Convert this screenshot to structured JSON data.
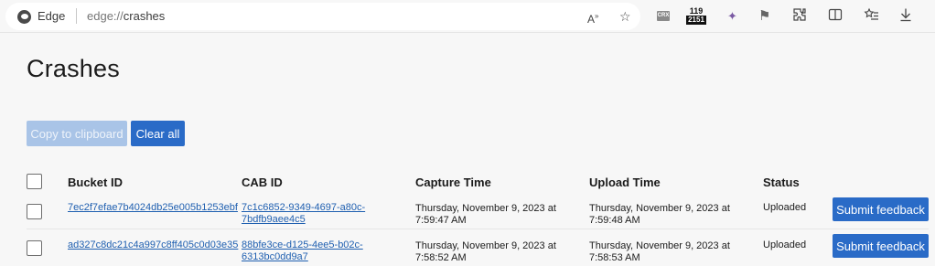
{
  "browser": {
    "name": "Edge",
    "url_scheme": "edge://",
    "url_path": "crashes",
    "read_aloud_label": "A",
    "read_aloud_sup": "»",
    "extension_crx": "CRX",
    "badge_top": "119",
    "badge_bottom": "2151",
    "icons": [
      "edge-logo-icon",
      "read-aloud-icon",
      "favorite-star-icon",
      "crx-extension-icon",
      "counter-badge-icon",
      "puzzle-icon",
      "flag-icon",
      "extensions-icon",
      "split-screen-icon",
      "favorites-icon",
      "download-icon"
    ]
  },
  "page": {
    "title": "Crashes",
    "copy_button": "Copy to clipboard",
    "clear_button": "Clear all"
  },
  "table": {
    "headers": {
      "bucket": "Bucket ID",
      "cab": "CAB ID",
      "capture": "Capture Time",
      "upload": "Upload Time",
      "status": "Status"
    },
    "rows": [
      {
        "bucket": "7ec2f7efae7b4024db25e005b1253ebf",
        "cab": "7c1c6852-9349-4697-a80c-7bdfb9aee4c5",
        "capture_date": "Thursday, November 9, 2023 at",
        "capture_time": "7:59:47 AM",
        "upload_date": "Thursday, November 9, 2023 at",
        "upload_time": "7:59:48 AM",
        "status": "Uploaded",
        "action": "Submit feedback"
      },
      {
        "bucket": "ad327c8dc21c4a997c8ff405c0d03e35",
        "cab": "88bfe3ce-d125-4ee5-b02c-6313bc0dd9a7",
        "capture_date": "Thursday, November 9, 2023 at",
        "capture_time": "7:58:52 AM",
        "upload_date": "Thursday, November 9, 2023 at",
        "upload_time": "7:58:53 AM",
        "status": "Uploaded",
        "action": "Submit feedback"
      }
    ]
  },
  "colors": {
    "accent": "#2a6bc7",
    "accent_disabled": "#a9c4e7",
    "link": "#1f5fb0",
    "background": "#f7f7f7"
  }
}
